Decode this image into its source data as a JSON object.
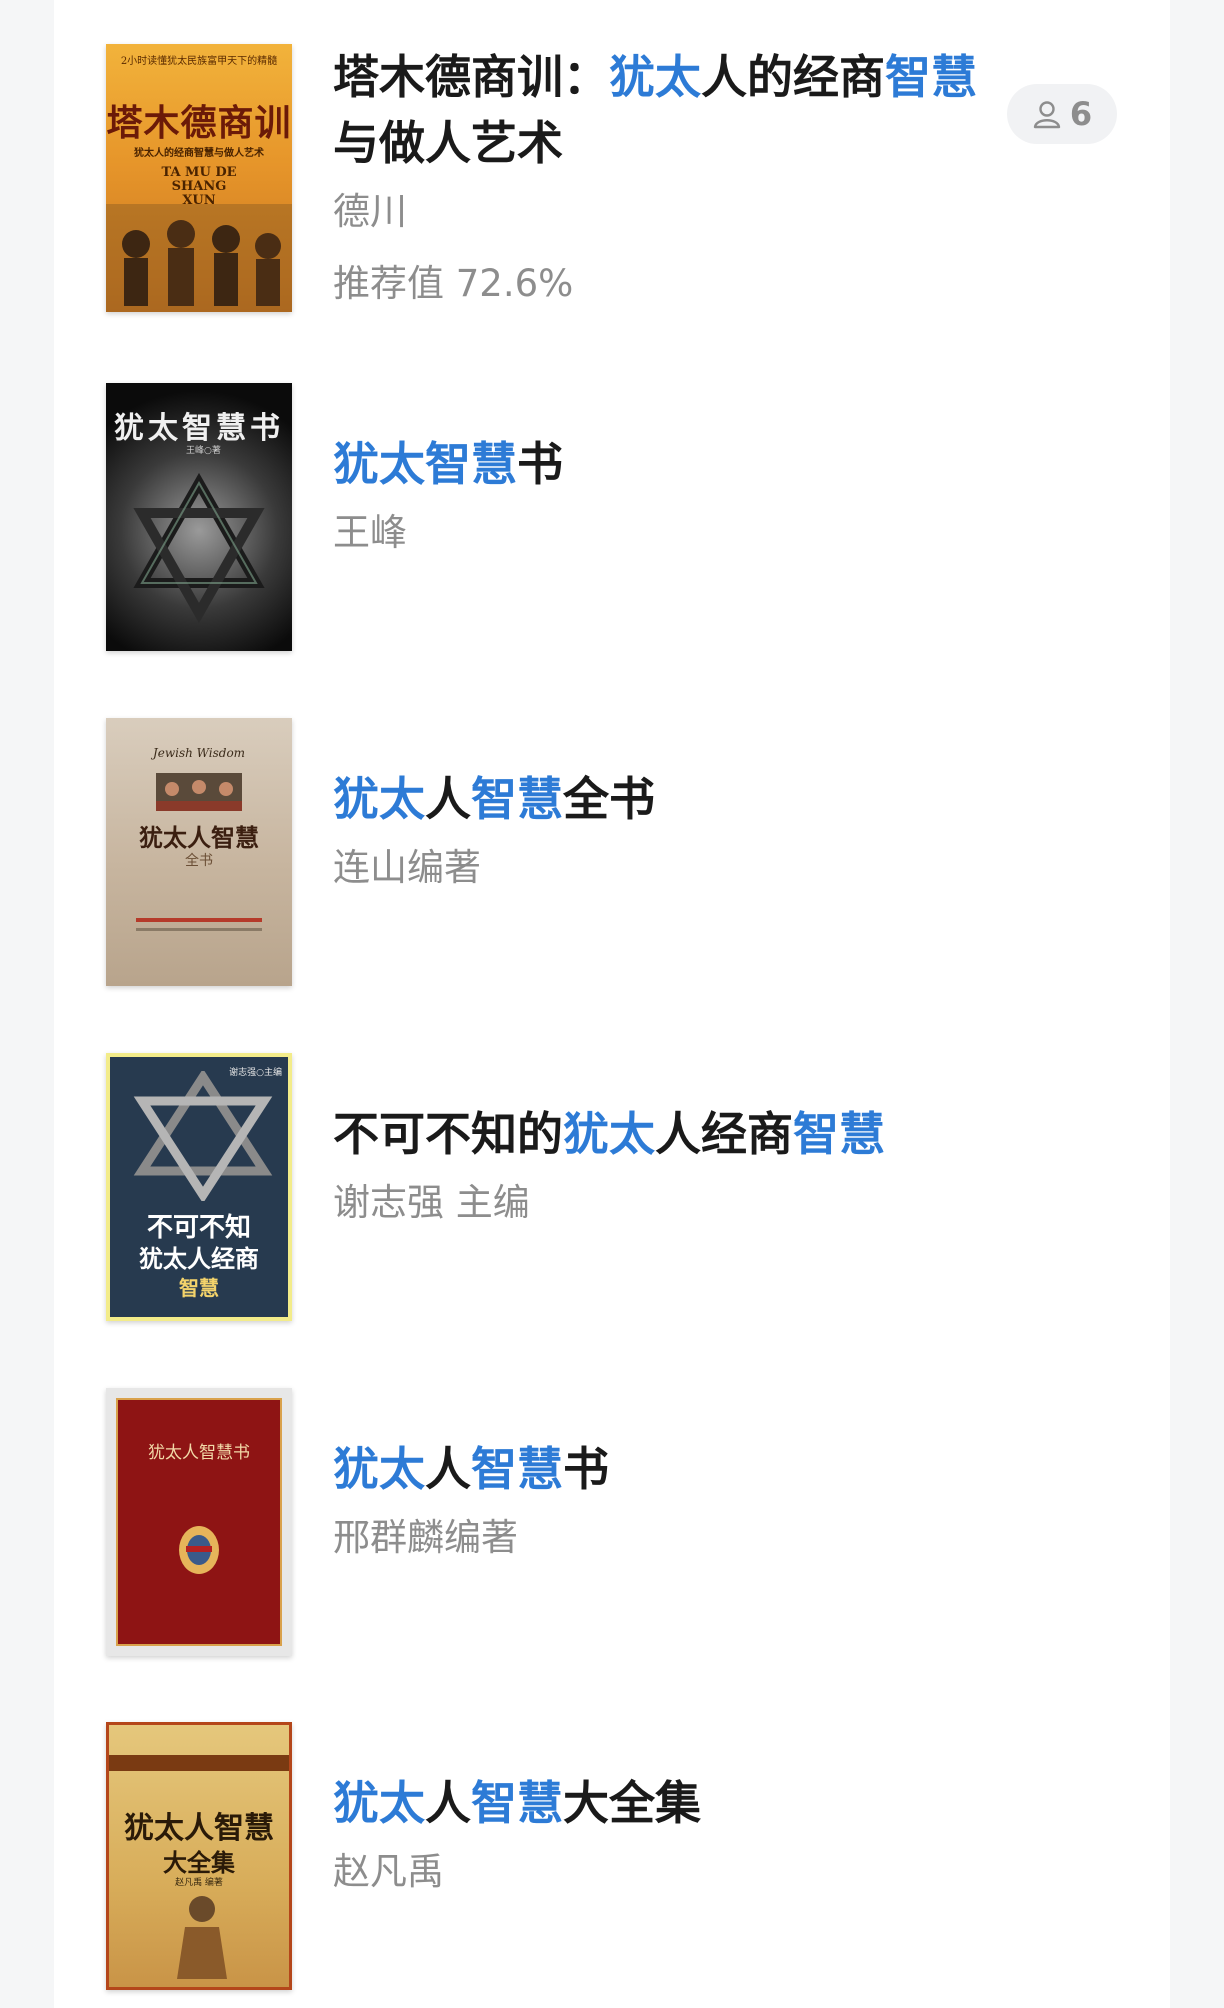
{
  "books": [
    {
      "title_parts": [
        {
          "text": "塔木德商训：",
          "hl": false
        },
        {
          "text": "犹太",
          "hl": true
        },
        {
          "text": "人的经商",
          "hl": false
        },
        {
          "text": "智慧",
          "hl": true
        },
        {
          "text": "与做人艺术",
          "hl": false
        }
      ],
      "author": "德川",
      "score": "推荐值 72.6%",
      "badge_count": "6",
      "cover": {
        "tagline": "2小时读懂犹太民族富甲天下的精髓",
        "main": "塔木德商训",
        "sub": "犹太人的经商智慧与做人艺术",
        "pinyin": "TA MU DE SHANG XUN"
      }
    },
    {
      "title_parts": [
        {
          "text": "犹太智慧",
          "hl": true
        },
        {
          "text": "书",
          "hl": false
        }
      ],
      "author": "王峰",
      "cover": {
        "main": "犹太智慧书",
        "byline": "王峰○著"
      }
    },
    {
      "title_parts": [
        {
          "text": "犹太",
          "hl": true
        },
        {
          "text": "人",
          "hl": false
        },
        {
          "text": "智慧",
          "hl": true
        },
        {
          "text": "全书",
          "hl": false
        }
      ],
      "author": "连山编著",
      "cover": {
        "eng": "Jewish Wisdom",
        "main": "犹太人智慧",
        "sub": "全书"
      }
    },
    {
      "title_parts": [
        {
          "text": "不可不知的",
          "hl": false
        },
        {
          "text": "犹太",
          "hl": true
        },
        {
          "text": "人经商",
          "hl": false
        },
        {
          "text": "智慧",
          "hl": true
        }
      ],
      "author": "谢志强 主编",
      "cover": {
        "byline": "谢志强○主编",
        "line1": "不可不知",
        "line2": "犹太人经商",
        "line3": "智慧"
      }
    },
    {
      "title_parts": [
        {
          "text": "犹太",
          "hl": true
        },
        {
          "text": "人",
          "hl": false
        },
        {
          "text": "智慧",
          "hl": true
        },
        {
          "text": "书",
          "hl": false
        }
      ],
      "author": "邢群麟编著",
      "cover": {
        "main": "犹太人智慧书"
      }
    },
    {
      "title_parts": [
        {
          "text": "犹太",
          "hl": true
        },
        {
          "text": "人",
          "hl": false
        },
        {
          "text": "智慧",
          "hl": true
        },
        {
          "text": "大全集",
          "hl": false
        }
      ],
      "author": "赵凡禹",
      "cover": {
        "main": "犹太人智慧",
        "sub": "大全集",
        "byline": "赵凡禹 编著"
      }
    }
  ]
}
